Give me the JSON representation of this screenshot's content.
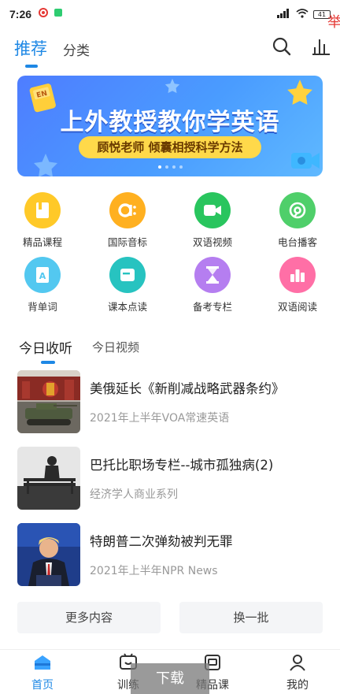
{
  "status": {
    "time": "7:26",
    "battery": "41"
  },
  "topnav": {
    "tab_active": "推荐",
    "tab_other": "分类"
  },
  "banner": {
    "title": "上外教授教你学英语",
    "subtitle": "顾悦老师 倾囊相授科学方法",
    "badge": "EN"
  },
  "grid": [
    {
      "label": "精品课程",
      "color": "#ffc928",
      "icon": "book-icon"
    },
    {
      "label": "国际音标",
      "color": "#ffb020",
      "icon": "phonetic-icon"
    },
    {
      "label": "双语视频",
      "color": "#29c55e",
      "icon": "video-icon"
    },
    {
      "label": "电台播客",
      "color": "#4fcf6a",
      "icon": "radio-icon"
    },
    {
      "label": "背单词",
      "color": "#53c8f0",
      "icon": "word-icon"
    },
    {
      "label": "课本点读",
      "color": "#27c3c0",
      "icon": "textbook-icon"
    },
    {
      "label": "备考专栏",
      "color": "#b57ef0",
      "icon": "hourglass-icon"
    },
    {
      "label": "双语阅读",
      "color": "#ff6fa6",
      "icon": "chart-icon"
    }
  ],
  "today": {
    "tab_active": "今日收听",
    "tab_other": "今日视频"
  },
  "list": [
    {
      "title": "美俄延长《新削减战略武器条约》",
      "subtitle": "2021年上半年VOA常速英语"
    },
    {
      "title": "巴托比职场专栏--城市孤独病(2)",
      "subtitle": "经济学人商业系列"
    },
    {
      "title": "特朗普二次弹劾被判无罪",
      "subtitle": "2021年上半年NPR News"
    }
  ],
  "buttons": {
    "more": "更多内容",
    "refresh": "换一批"
  },
  "bottom": {
    "home": "首页",
    "train": "训练",
    "course": "精品课",
    "mine": "我的",
    "download": "下载"
  },
  "edge_char": "举",
  "colors": {
    "accent": "#1e88e5"
  }
}
